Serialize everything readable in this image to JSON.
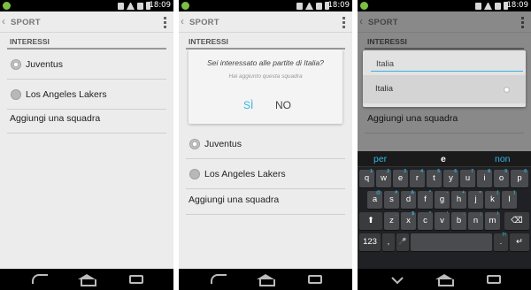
{
  "status_bar": {
    "time": "18:09"
  },
  "action_bar": {
    "title": "SPORT"
  },
  "screen1": {
    "section_header": "INTERESSI",
    "items": [
      {
        "label": "Juventus",
        "icon": "soccer-ball-icon"
      },
      {
        "label": "Los Angeles Lakers",
        "icon": "basketball-icon"
      }
    ],
    "add_team": "Aggiungi una squadra"
  },
  "screen2": {
    "section_header": "INTERESSI",
    "dialog": {
      "title": "Sei interessato alle partite di Italia?",
      "subtitle": "Hai aggiunto questa squadra",
      "yes": "SÌ",
      "no": "NO"
    },
    "items": [
      {
        "label": "Juventus",
        "icon": "soccer-ball-icon"
      },
      {
        "label": "Los Angeles Lakers",
        "icon": "basketball-icon"
      }
    ],
    "add_team": "Aggiungi una squadra"
  },
  "screen3": {
    "section_header": "INTERESSI",
    "input_value": "Italia",
    "suggestion": "Italia",
    "add_team": "Aggiungi una squadra",
    "keyboard": {
      "suggestions": [
        "per",
        "e",
        "non"
      ],
      "row1": [
        "q",
        "w",
        "e",
        "r",
        "t",
        "y",
        "u",
        "i",
        "o",
        "p"
      ],
      "row1_hints": [
        "1",
        "2",
        "3",
        "4",
        "5",
        "6",
        "7",
        "8",
        "9",
        "0"
      ],
      "row2": [
        "a",
        "s",
        "d",
        "f",
        "g",
        "h",
        "j",
        "k",
        "l"
      ],
      "row2_hints": [
        "@",
        "#",
        "&",
        "*",
        "-",
        "+",
        "=",
        "(",
        ")"
      ],
      "row3": [
        "z",
        "x",
        "c",
        "v",
        "b",
        "n",
        "m"
      ],
      "row3_hints": [
        "_",
        "$",
        "\"",
        "'",
        ":",
        ";",
        "/"
      ],
      "shift": "⬆",
      "backspace": "⌫",
      "numbers": "123",
      "comma": ",",
      "mic": "🎤",
      "period": ".",
      "period_hint": "?!",
      "enter": "↵"
    }
  },
  "colors": {
    "accent": "#33b5e5",
    "background": "#ececec",
    "statusbar": "#000000",
    "keyboard": "#202124"
  }
}
